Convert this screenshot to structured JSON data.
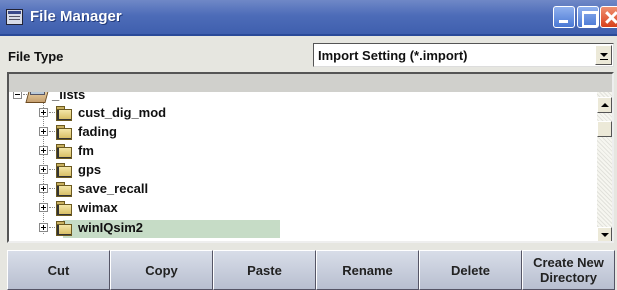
{
  "window": {
    "title": "File Manager",
    "icon": "file-manager-icon"
  },
  "file_type": {
    "label": "File Type",
    "selected": "Import Setting (*.import)"
  },
  "tree": {
    "root": {
      "label": "_lists",
      "icon": "folder-open-icon",
      "expanded": true
    },
    "items": [
      {
        "label": "cust_dig_mod",
        "icon": "folder-icon",
        "expanded": false
      },
      {
        "label": "fading",
        "icon": "folder-icon",
        "expanded": false
      },
      {
        "label": "fm",
        "icon": "folder-icon",
        "expanded": false
      },
      {
        "label": "gps",
        "icon": "folder-icon",
        "expanded": false
      },
      {
        "label": "save_recall",
        "icon": "folder-icon",
        "expanded": false
      },
      {
        "label": "wimax",
        "icon": "folder-icon",
        "expanded": false
      },
      {
        "label": "winIQsim2",
        "icon": "folder-icon",
        "expanded": false,
        "selected": true
      }
    ],
    "selection_color": "#c6dcc6"
  },
  "buttons": {
    "cut": "Cut",
    "copy": "Copy",
    "paste": "Paste",
    "rename": "Rename",
    "delete": "Delete",
    "create_dir": "Create New\nDirectory"
  },
  "colors": {
    "titlebar": "#4d6cb8",
    "close_button": "#d8401c",
    "panel_bg": "#e6e6e0"
  }
}
